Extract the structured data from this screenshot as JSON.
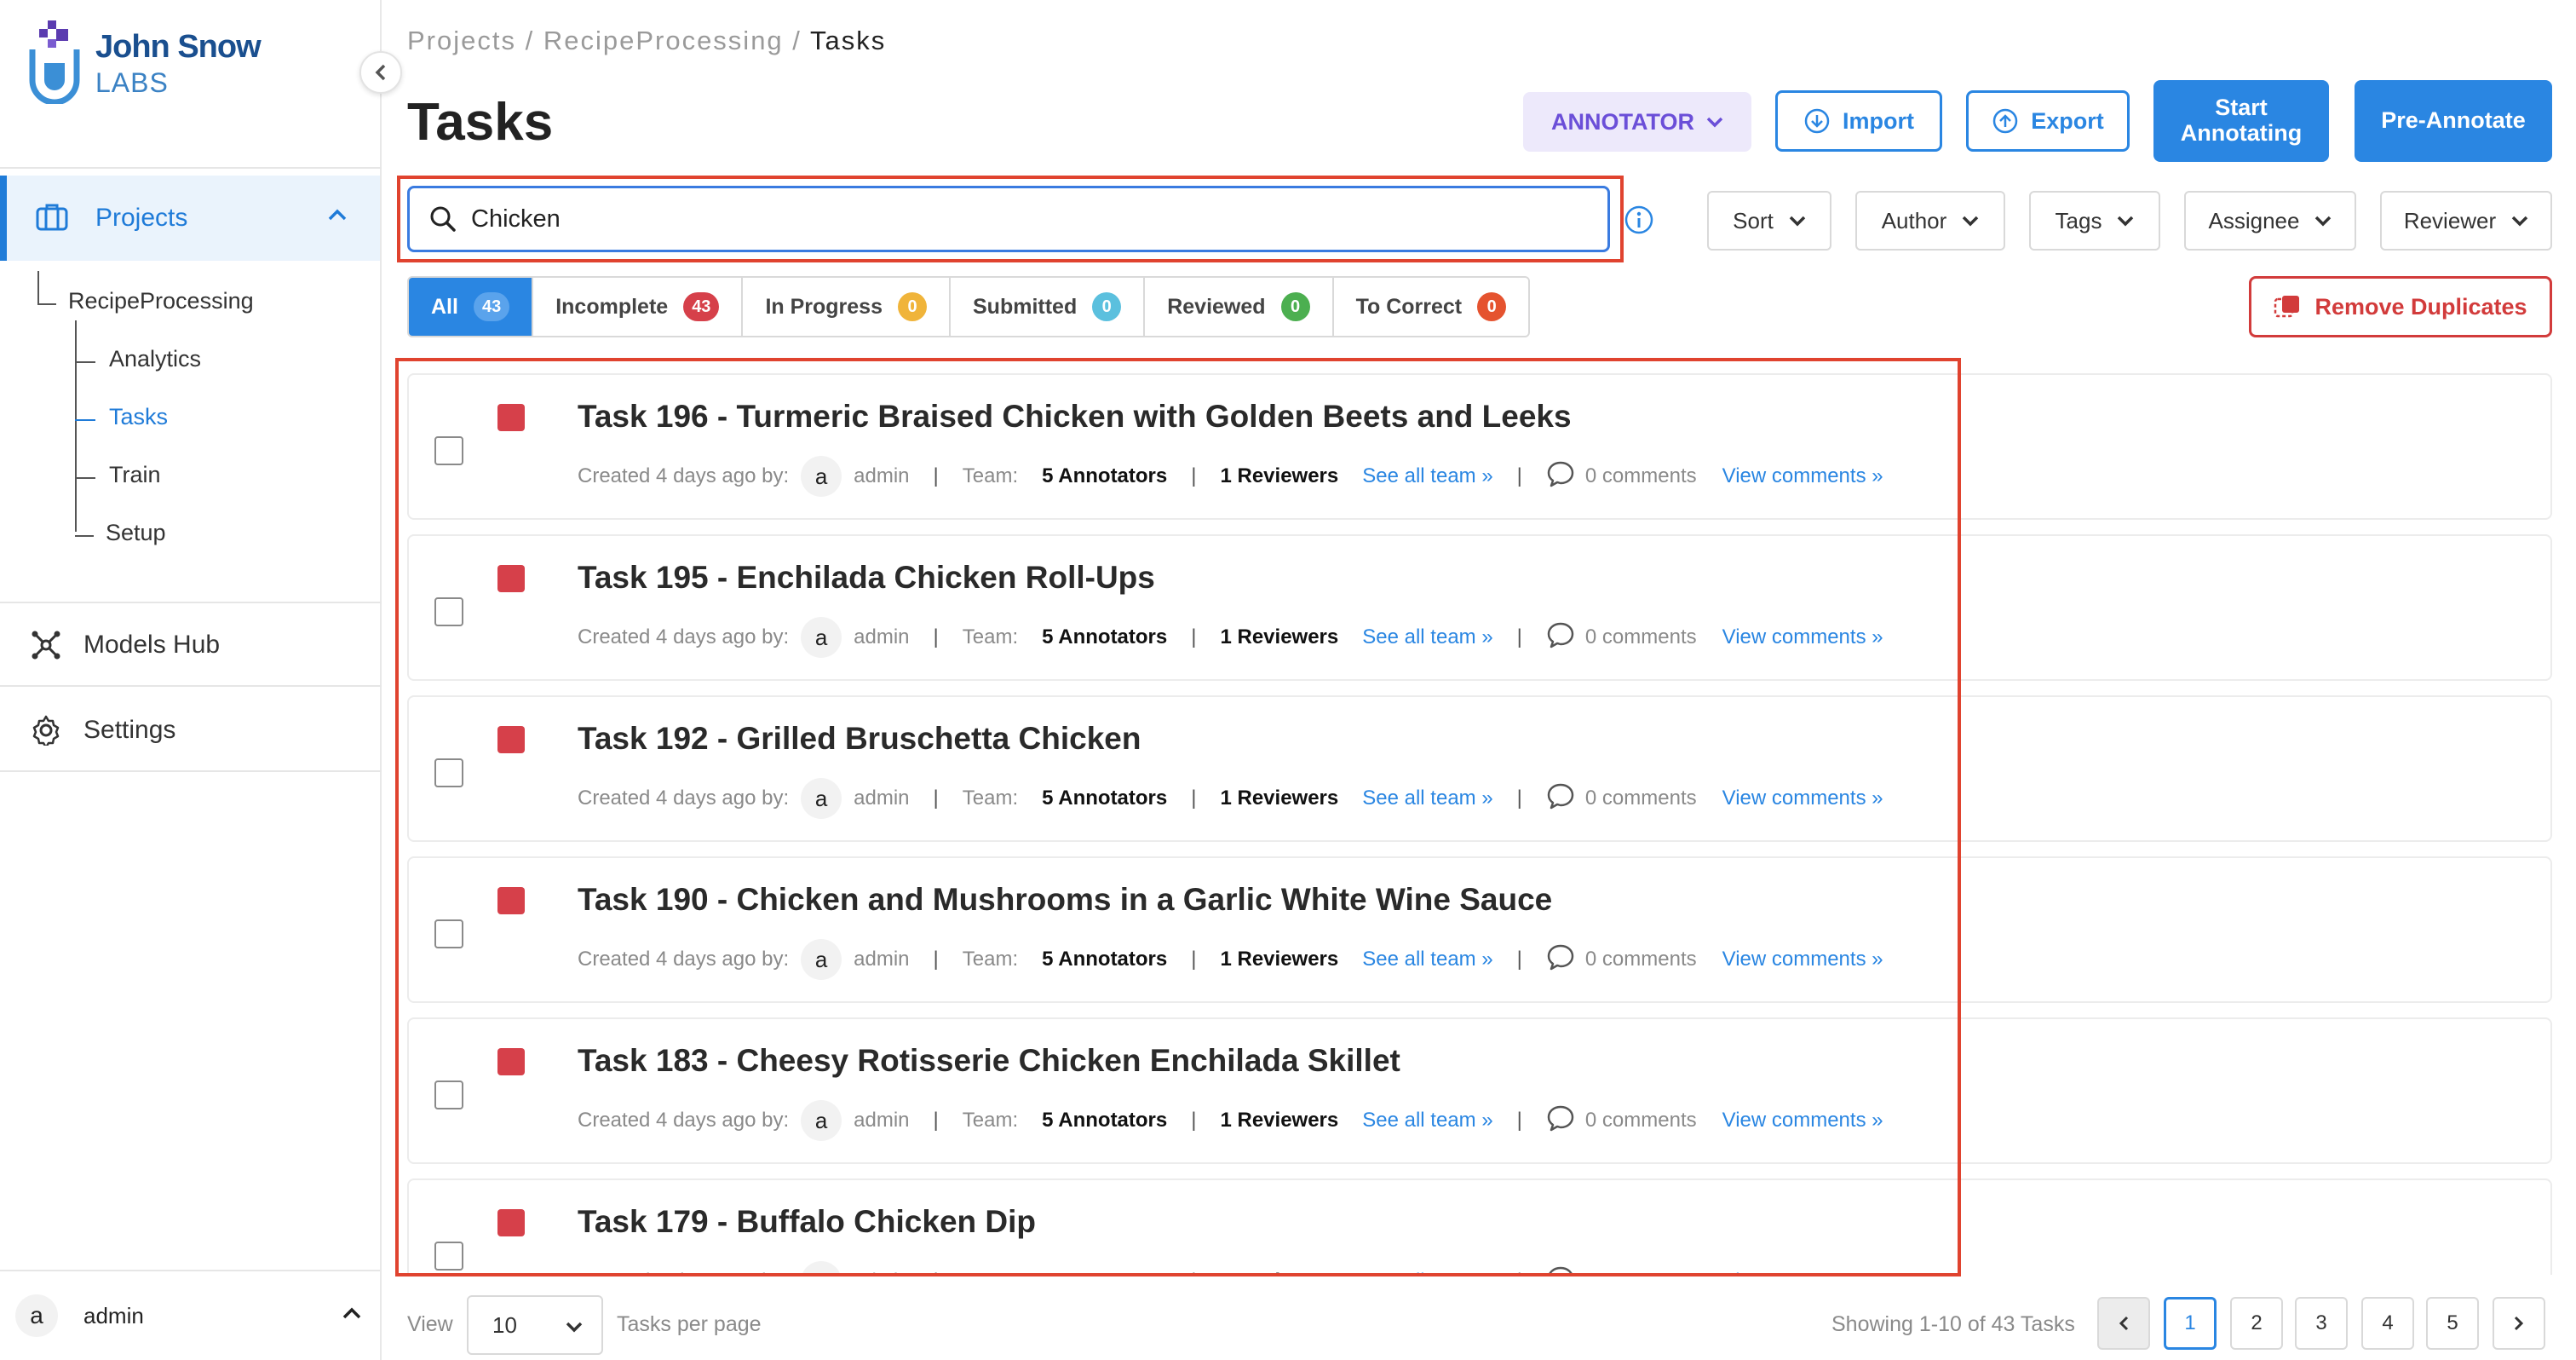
{
  "brand": {
    "line1": "John Snow",
    "line2": "LABS"
  },
  "sidebar": {
    "projects_label": "Projects",
    "project_name": "RecipeProcessing",
    "sub_items": [
      "Analytics",
      "Tasks",
      "Train",
      "Setup"
    ],
    "models_hub_label": "Models Hub",
    "settings_label": "Settings",
    "user": {
      "initial": "a",
      "name": "admin"
    }
  },
  "breadcrumb": {
    "part1": "Projects",
    "sep": " / ",
    "part2": "RecipeProcessing",
    "current": "Tasks"
  },
  "page_title": "Tasks",
  "toolbar": {
    "role_label": "ANNOTATOR",
    "import_label": "Import",
    "export_label": "Export",
    "start_line1": "Start",
    "start_line2": "Annotating",
    "preannotate_label": "Pre-Annotate"
  },
  "search": {
    "value": "Chicken"
  },
  "filters": [
    "Sort",
    "Author",
    "Tags",
    "Assignee",
    "Reviewer"
  ],
  "status_tabs": [
    {
      "label": "All",
      "count": "43",
      "color": "#5aa3ec"
    },
    {
      "label": "Incomplete",
      "count": "43",
      "color": "#d6404a"
    },
    {
      "label": "In Progress",
      "count": "0",
      "color": "#f0b43a"
    },
    {
      "label": "Submitted",
      "count": "0",
      "color": "#5bc0de"
    },
    {
      "label": "Reviewed",
      "count": "0",
      "color": "#4caf50"
    },
    {
      "label": "To Correct",
      "count": "0",
      "color": "#e5532f"
    }
  ],
  "remove_duplicates_label": "Remove Duplicates",
  "task_meta": {
    "created_prefix": "Created 4 days ago by:",
    "author_initial": "a",
    "author": "admin",
    "team_label": "Team:",
    "annotators": "5 Annotators",
    "reviewers": "1 Reviewers",
    "see_team": "See all team »",
    "comments": "0 comments",
    "view_comments": "View comments »"
  },
  "tasks": [
    {
      "title": "Task 196 - Turmeric Braised Chicken with Golden Beets and Leeks"
    },
    {
      "title": "Task 195 - Enchilada Chicken Roll-Ups"
    },
    {
      "title": "Task 192 - Grilled Bruschetta Chicken"
    },
    {
      "title": "Task 190 - Chicken and Mushrooms in a Garlic White Wine Sauce"
    },
    {
      "title": "Task 183 - Cheesy Rotisserie Chicken Enchilada Skillet"
    },
    {
      "title": "Task 179 - Buffalo Chicken Dip"
    }
  ],
  "footer": {
    "view_label": "View",
    "per_page_value": "10",
    "per_page_label": "Tasks per page",
    "showing": "Showing 1-10 of 43 Tasks",
    "pages": [
      "1",
      "2",
      "3",
      "4",
      "5"
    ]
  },
  "colors": {
    "accent": "#2a86e2",
    "danger": "#d23b3b",
    "highlight": "#e0432f"
  }
}
